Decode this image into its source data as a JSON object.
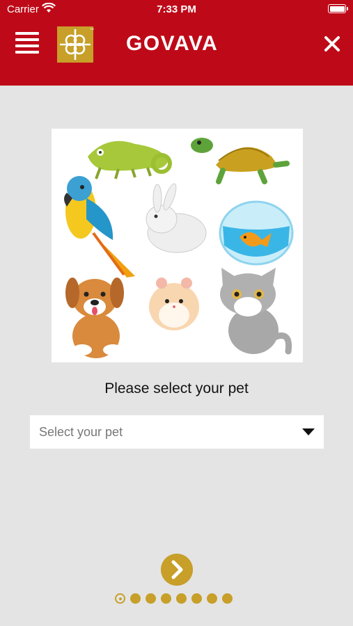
{
  "status_bar": {
    "carrier": "Carrier",
    "time": "7:33 PM"
  },
  "header": {
    "brand": "GOVAVA",
    "menu_icon": "hamburger-menu-icon",
    "close_icon": "close-icon",
    "background_color": "#be0a18"
  },
  "main": {
    "illustration": "pets-illustration",
    "prompt": "Please select your pet",
    "select": {
      "placeholder": "Select your pet",
      "arrow_icon": "dropdown-arrow-icon"
    }
  },
  "pager": {
    "next_icon": "chevron-right-icon",
    "total_steps": 8,
    "current_step": 1,
    "accent_color": "#c79f29"
  }
}
